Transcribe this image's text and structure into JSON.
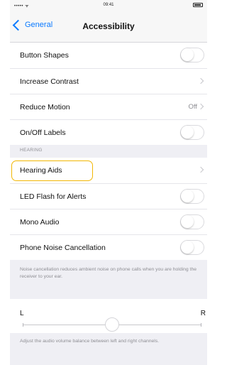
{
  "status_bar": {
    "signal": "••••• ᯤ",
    "time": "09:41"
  },
  "nav": {
    "back_label": "General",
    "title": "Accessibility"
  },
  "rows_top": [
    {
      "label": "Button Shapes",
      "control": "toggle",
      "on": false
    },
    {
      "label": "Increase Contrast",
      "control": "disclosure"
    },
    {
      "label": "Reduce Motion",
      "control": "disclosure",
      "value": "Off"
    },
    {
      "label": "On/Off Labels",
      "control": "toggle",
      "on": false
    }
  ],
  "hearing": {
    "header": "HEARING",
    "rows": [
      {
        "label": "Hearing Aids",
        "control": "disclosure",
        "highlighted": true
      },
      {
        "label": "LED Flash for Alerts",
        "control": "toggle",
        "on": false
      },
      {
        "label": "Mono Audio",
        "control": "toggle",
        "on": false
      },
      {
        "label": "Phone Noise Cancellation",
        "control": "toggle",
        "on": false
      }
    ],
    "footer": "Noise cancellation reduces ambient noise on phone calls when you are holding the receiver to your ear."
  },
  "balance": {
    "left_label": "L",
    "right_label": "R",
    "value": 0.5,
    "footer": "Adjust the audio volume balance between left and right channels."
  },
  "colors": {
    "accent": "#0a7aff",
    "highlight": "#f2b705",
    "background": "#efeff4"
  }
}
